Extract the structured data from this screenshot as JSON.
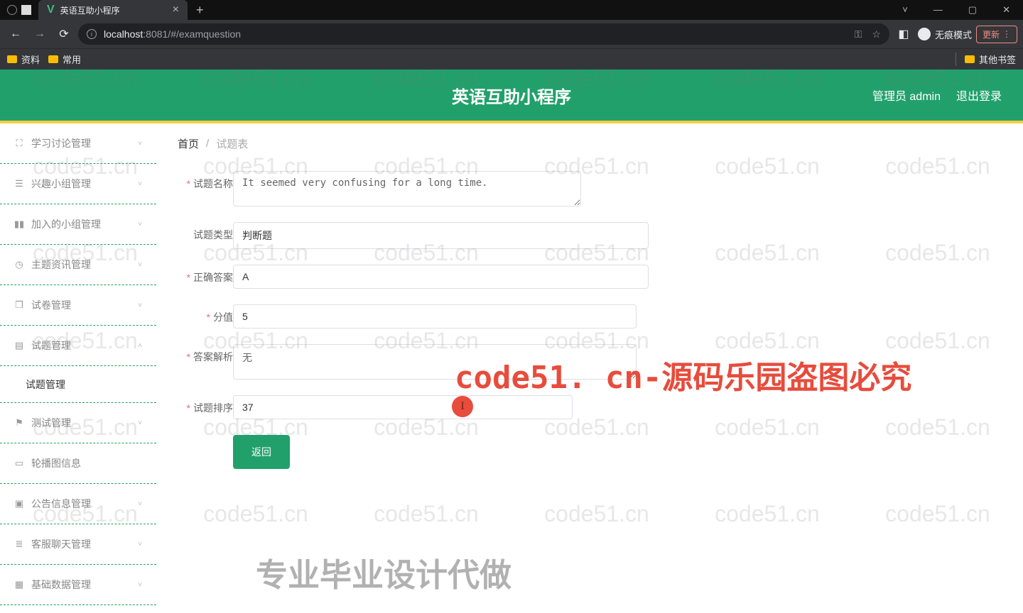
{
  "browser": {
    "tab_title": "英语互助小程序",
    "url_host": "localhost",
    "url_path": ":8081/#/examquestion",
    "bookmarks": {
      "b1": "资料",
      "b2": "常用",
      "other": "其他书签"
    },
    "incognito": "无痕模式",
    "update": "更新"
  },
  "header": {
    "title": "英语互助小程序",
    "user": "管理员 admin",
    "logout": "退出登录"
  },
  "sidebar": {
    "items": [
      {
        "label": "学习讨论管理",
        "chev": "˅"
      },
      {
        "label": "兴趣小组管理",
        "chev": "˅"
      },
      {
        "label": "加入的小组管理",
        "chev": "˅"
      },
      {
        "label": "主题资讯管理",
        "chev": "˅"
      },
      {
        "label": "试卷管理",
        "chev": "˅"
      },
      {
        "label": "试题管理",
        "chev": "˄"
      },
      {
        "label": "测试管理",
        "chev": "˅"
      },
      {
        "label": "轮播图信息",
        "chev": ""
      },
      {
        "label": "公告信息管理",
        "chev": "˅"
      },
      {
        "label": "客服聊天管理",
        "chev": "˅"
      },
      {
        "label": "基础数据管理",
        "chev": "˅"
      }
    ],
    "sub": "试题管理"
  },
  "breadcrumb": {
    "home": "首页",
    "sep": "/",
    "current": "试题表"
  },
  "form": {
    "name_label": "试题名称",
    "name_value": "It seemed very confusing for a long time.",
    "type_label": "试题类型",
    "type_value": "判断题",
    "answer_label": "正确答案",
    "answer_value": "A",
    "score_label": "分值",
    "score_value": "5",
    "analysis_label": "答案解析",
    "analysis_value": "无",
    "order_label": "试题排序",
    "order_value": "37",
    "return": "返回"
  },
  "watermark": {
    "cell": "code51.cn",
    "red": "code51. cn-源码乐园盗图必究",
    "gray": "专业毕业设计代做"
  }
}
